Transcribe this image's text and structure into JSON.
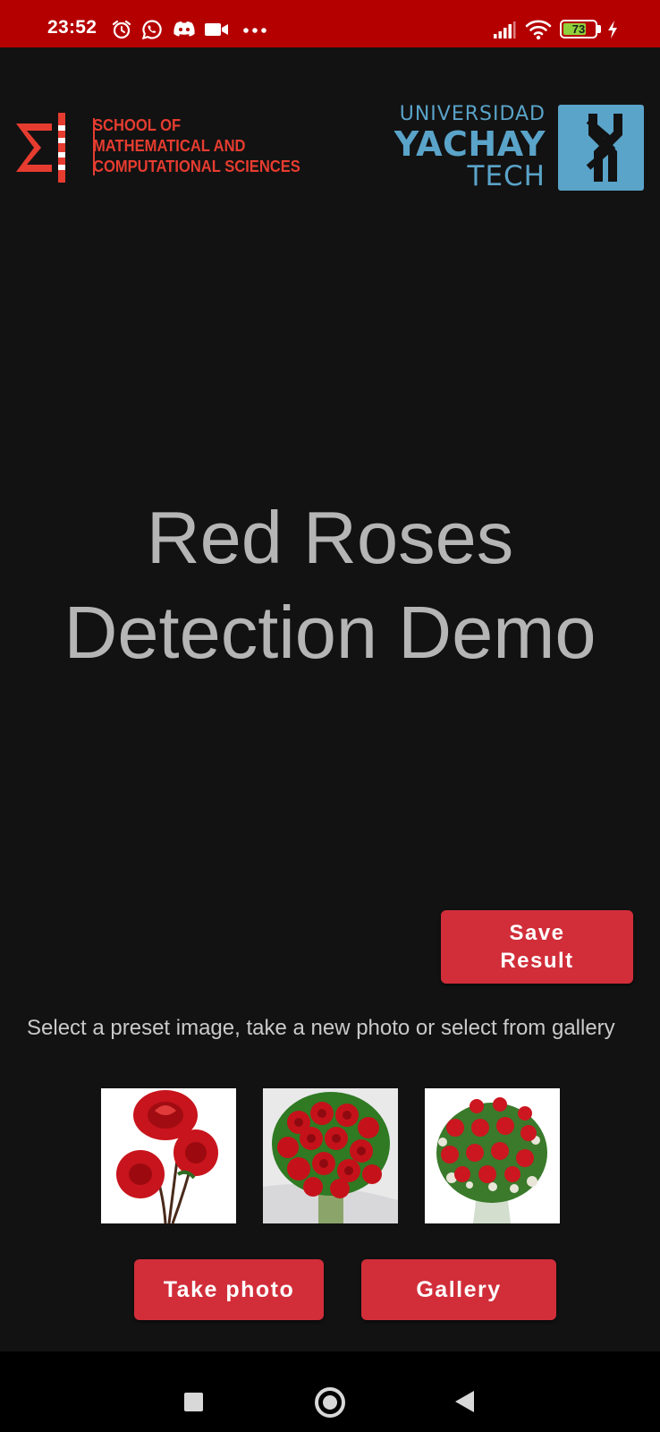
{
  "status_bar": {
    "time": "23:52",
    "icons": [
      "alarm-icon",
      "whatsapp-icon",
      "discord-icon",
      "video-camera-icon",
      "more-dots-icon",
      "signal-icon",
      "wifi-icon",
      "battery-icon",
      "charging-bolt-icon"
    ],
    "battery_level": "73",
    "battery_fraction": 0.73,
    "background_color": "#b50000"
  },
  "header": {
    "left_logo": {
      "lines": [
        "SCHOOL OF",
        "MATHEMATICAL AND",
        "COMPUTATIONAL SCIENCES"
      ],
      "color": "#e63c30"
    },
    "right_logo": {
      "line1": "UNIVERSIDAD",
      "line2": "YACHAY",
      "line3": "TECH",
      "color": "#5aa3c9"
    }
  },
  "main": {
    "title_line1": "Red Roses",
    "title_line2": "Detection Demo",
    "save_button_label_line1": "Save",
    "save_button_label_line2": "Result",
    "instructions": "Select a preset image, take a new photo or select from gallery",
    "preset_images": [
      "roses-three-stems",
      "roses-bouquet",
      "roses-vase"
    ],
    "take_photo_label": "Take photo",
    "gallery_label": "Gallery",
    "accent_color": "#d12e3a"
  },
  "nav_bar": {
    "icons": [
      "recent-apps-icon",
      "home-icon",
      "back-icon"
    ]
  }
}
